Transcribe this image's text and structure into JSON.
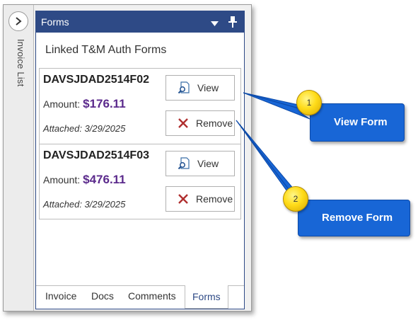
{
  "sidebar": {
    "label": "Invoice List"
  },
  "pane": {
    "title": "Forms"
  },
  "section_title": "Linked T&M Auth Forms",
  "forms": [
    {
      "id": "DAVSJDAD2514F02",
      "amount_label": "Amount:",
      "amount": "$176.11",
      "attached": "Attached: 3/29/2025",
      "view_label": "View",
      "remove_label": "Remove"
    },
    {
      "id": "DAVSJDAD2514F03",
      "amount_label": "Amount:",
      "amount": "$476.11",
      "attached": "Attached: 3/29/2025",
      "view_label": "View",
      "remove_label": "Remove"
    }
  ],
  "tabs": [
    {
      "label": "Invoice"
    },
    {
      "label": "Docs"
    },
    {
      "label": "Comments"
    },
    {
      "label": "Forms",
      "active": true
    }
  ],
  "callouts": [
    {
      "number": "1",
      "text": "View Form"
    },
    {
      "number": "2",
      "text": "Remove Form"
    }
  ],
  "colors": {
    "header": "#2e4a86",
    "amount": "#5b2a8c",
    "callout": "#1866d6",
    "remove_x": "#b03030",
    "badge": "#ffdc1a"
  }
}
